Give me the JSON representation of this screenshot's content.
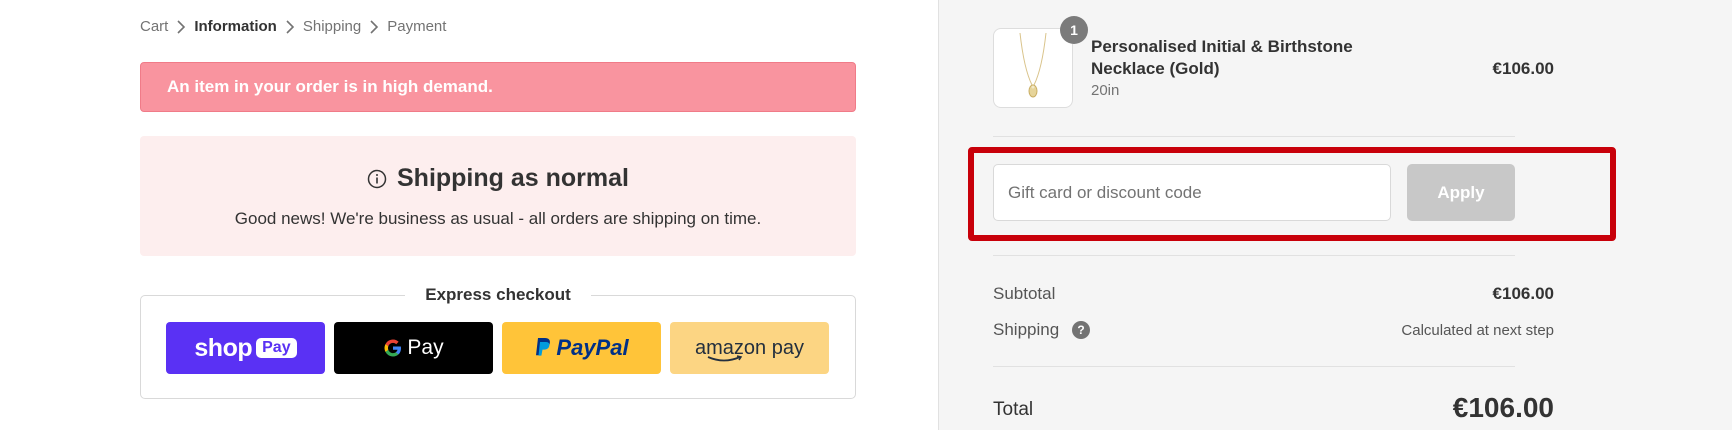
{
  "breadcrumb": {
    "items": [
      {
        "label": "Cart",
        "active": false
      },
      {
        "label": "Information",
        "active": true
      },
      {
        "label": "Shipping",
        "active": false
      },
      {
        "label": "Payment",
        "active": false
      }
    ]
  },
  "alert": {
    "text": "An item in your order is in high demand."
  },
  "notice": {
    "title": "Shipping as normal",
    "text": "Good news! We're business as usual - all orders are shipping on time."
  },
  "express": {
    "label": "Express checkout",
    "buttons": {
      "shoppay_shop": "shop",
      "shoppay_pay": "Pay",
      "gpay": "Pay",
      "paypal": "PayPal",
      "amazon": "amazon pay"
    }
  },
  "order": {
    "quantity_badge": "1",
    "product_name": "Personalised Initial & Birthstone Necklace (Gold)",
    "variant": "20in",
    "price": "€106.00"
  },
  "discount": {
    "placeholder": "Gift card or discount code",
    "apply_label": "Apply"
  },
  "summary": {
    "subtotal_label": "Subtotal",
    "subtotal_value": "€106.00",
    "shipping_label": "Shipping",
    "shipping_help": "?",
    "shipping_value": "Calculated at next step",
    "total_label": "Total",
    "total_value": "€106.00"
  },
  "colors": {
    "alert_bg": "#f9949f",
    "notice_bg": "#fdeeee",
    "shoppay": "#5a31f4",
    "paypal": "#ffc439",
    "amazon": "#fcd583",
    "highlight": "#c8000a"
  }
}
